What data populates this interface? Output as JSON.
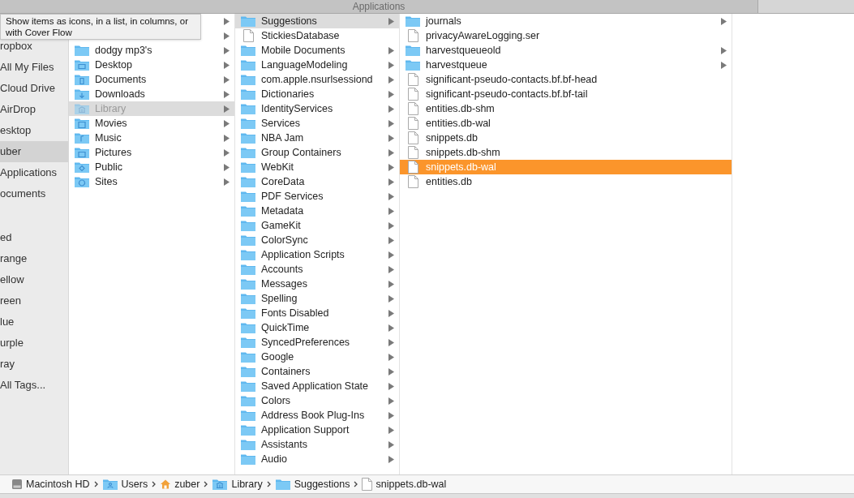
{
  "window": {
    "title": "Applications"
  },
  "tooltip": "Show items as icons, in a list, in columns, or with Cover Flow",
  "sidebar": {
    "items": [
      {
        "label": "ropbox",
        "selected": false
      },
      {
        "label": "All My Files",
        "selected": false
      },
      {
        "label": "Cloud Drive",
        "selected": false
      },
      {
        "label": "AirDrop",
        "selected": false
      },
      {
        "label": "esktop",
        "selected": false
      },
      {
        "label": "uber",
        "selected": true
      },
      {
        "label": "Applications",
        "selected": false
      },
      {
        "label": "ocuments",
        "selected": false
      }
    ],
    "tags": [
      {
        "label": "ed"
      },
      {
        "label": "range"
      },
      {
        "label": "ellow"
      },
      {
        "label": "reen"
      },
      {
        "label": "lue"
      },
      {
        "label": "urple"
      },
      {
        "label": "ray"
      },
      {
        "label": "All Tags..."
      }
    ]
  },
  "columns": [
    {
      "items": [
        {
          "kind": "hidden",
          "has_children": true,
          "selected": false
        },
        {
          "kind": "hidden",
          "has_children": true,
          "selected": false
        },
        {
          "kind": "folder",
          "name": "dodgy mp3's",
          "has_children": true,
          "selected": false
        },
        {
          "kind": "desktop",
          "name": "Desktop",
          "has_children": true,
          "selected": false
        },
        {
          "kind": "documents",
          "name": "Documents",
          "has_children": true,
          "selected": false
        },
        {
          "kind": "downloads",
          "name": "Downloads",
          "has_children": true,
          "selected": false
        },
        {
          "kind": "library",
          "name": "Library",
          "has_children": true,
          "selected": true
        },
        {
          "kind": "movies",
          "name": "Movies",
          "has_children": true,
          "selected": false
        },
        {
          "kind": "music",
          "name": "Music",
          "has_children": true,
          "selected": false
        },
        {
          "kind": "pictures",
          "name": "Pictures",
          "has_children": true,
          "selected": false
        },
        {
          "kind": "public",
          "name": "Public",
          "has_children": true,
          "selected": false
        },
        {
          "kind": "sites",
          "name": "Sites",
          "has_children": true,
          "selected": false
        }
      ]
    },
    {
      "items": [
        {
          "kind": "folder",
          "name": "Suggestions",
          "has_children": true,
          "selected": true
        },
        {
          "kind": "file",
          "name": "StickiesDatabase",
          "has_children": false,
          "selected": false
        },
        {
          "kind": "folder",
          "name": "Mobile Documents",
          "has_children": true,
          "selected": false
        },
        {
          "kind": "folder",
          "name": "LanguageModeling",
          "has_children": true,
          "selected": false
        },
        {
          "kind": "folder",
          "name": "com.apple.nsurlsessiond",
          "has_children": true,
          "selected": false
        },
        {
          "kind": "folder",
          "name": "Dictionaries",
          "has_children": true,
          "selected": false
        },
        {
          "kind": "folder",
          "name": "IdentityServices",
          "has_children": true,
          "selected": false
        },
        {
          "kind": "folder",
          "name": "Services",
          "has_children": true,
          "selected": false
        },
        {
          "kind": "folder",
          "name": "NBA Jam",
          "has_children": true,
          "selected": false
        },
        {
          "kind": "folder",
          "name": "Group Containers",
          "has_children": true,
          "selected": false
        },
        {
          "kind": "folder",
          "name": "WebKit",
          "has_children": true,
          "selected": false
        },
        {
          "kind": "folder",
          "name": "CoreData",
          "has_children": true,
          "selected": false
        },
        {
          "kind": "folder",
          "name": "PDF Services",
          "has_children": true,
          "selected": false
        },
        {
          "kind": "folder",
          "name": "Metadata",
          "has_children": true,
          "selected": false
        },
        {
          "kind": "folder",
          "name": "GameKit",
          "has_children": true,
          "selected": false
        },
        {
          "kind": "folder",
          "name": "ColorSync",
          "has_children": true,
          "selected": false
        },
        {
          "kind": "folder",
          "name": "Application Scripts",
          "has_children": true,
          "selected": false
        },
        {
          "kind": "folder",
          "name": "Accounts",
          "has_children": true,
          "selected": false
        },
        {
          "kind": "folder",
          "name": "Messages",
          "has_children": true,
          "selected": false
        },
        {
          "kind": "folder",
          "name": "Spelling",
          "has_children": true,
          "selected": false
        },
        {
          "kind": "folder",
          "name": "Fonts Disabled",
          "has_children": true,
          "selected": false
        },
        {
          "kind": "folder",
          "name": "QuickTime",
          "has_children": true,
          "selected": false
        },
        {
          "kind": "folder",
          "name": "SyncedPreferences",
          "has_children": true,
          "selected": false
        },
        {
          "kind": "folder",
          "name": "Google",
          "has_children": true,
          "selected": false
        },
        {
          "kind": "folder",
          "name": "Containers",
          "has_children": true,
          "selected": false
        },
        {
          "kind": "folder",
          "name": "Saved Application State",
          "has_children": true,
          "selected": false
        },
        {
          "kind": "folder",
          "name": "Colors",
          "has_children": true,
          "selected": false
        },
        {
          "kind": "folder",
          "name": "Address Book Plug-Ins",
          "has_children": true,
          "selected": false
        },
        {
          "kind": "folder",
          "name": "Application Support",
          "has_children": true,
          "selected": false
        },
        {
          "kind": "folder",
          "name": "Assistants",
          "has_children": true,
          "selected": false
        },
        {
          "kind": "folder",
          "name": "Audio",
          "has_children": true,
          "selected": false
        }
      ]
    },
    {
      "items": [
        {
          "kind": "folder",
          "name": "journals",
          "has_children": true,
          "selected": false
        },
        {
          "kind": "file",
          "name": "privacyAwareLogging.ser",
          "has_children": false,
          "selected": false
        },
        {
          "kind": "folder",
          "name": "harvestqueueold",
          "has_children": true,
          "selected": false
        },
        {
          "kind": "folder",
          "name": "harvestqueue",
          "has_children": true,
          "selected": false
        },
        {
          "kind": "file",
          "name": "significant-pseudo-contacts.bf.bf-head",
          "has_children": false,
          "selected": false
        },
        {
          "kind": "file",
          "name": "significant-pseudo-contacts.bf.bf-tail",
          "has_children": false,
          "selected": false
        },
        {
          "kind": "file",
          "name": "entities.db-shm",
          "has_children": false,
          "selected": false
        },
        {
          "kind": "file",
          "name": "entities.db-wal",
          "has_children": false,
          "selected": false
        },
        {
          "kind": "file",
          "name": "snippets.db",
          "has_children": false,
          "selected": false
        },
        {
          "kind": "file",
          "name": "snippets.db-shm",
          "has_children": false,
          "selected": false
        },
        {
          "kind": "file",
          "name": "snippets.db-wal",
          "has_children": false,
          "selected": true
        },
        {
          "kind": "file",
          "name": "entities.db",
          "has_children": false,
          "selected": false
        }
      ]
    }
  ],
  "path_bar": [
    {
      "kind": "disk",
      "label": "Macintosh HD"
    },
    {
      "kind": "users",
      "label": "Users"
    },
    {
      "kind": "home",
      "label": "zuber"
    },
    {
      "kind": "library",
      "label": "Library"
    },
    {
      "kind": "folder",
      "label": "Suggestions"
    },
    {
      "kind": "file",
      "label": "snippets.db-wal"
    }
  ]
}
